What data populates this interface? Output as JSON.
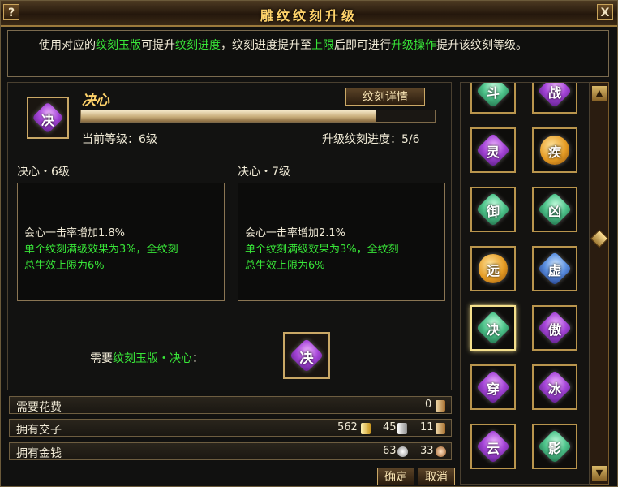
{
  "window": {
    "title": "雕纹纹刻升级",
    "help_label": "?",
    "close_label": "X"
  },
  "notice": {
    "p1": "使用对应的",
    "g1": "纹刻玉版",
    "p2": "可提升",
    "g2": "纹刻进度",
    "p3": "，纹刻进度提升至",
    "g3": "上限",
    "p4": "后即可进行",
    "g4": "升级操作",
    "p5": "提升该纹刻等级。"
  },
  "skill": {
    "icon_glyph": "决",
    "name": "决心",
    "detail_button": "纹刻详情",
    "progress_ratio": 0.8333,
    "current_level_label": "当前等级：6级",
    "progress_label": "升级纹刻进度：5/6"
  },
  "current": {
    "header": "决心・6级",
    "line1": "会心一击率增加1.8%",
    "line2": "单个纹刻满级效果为3%，全纹刻",
    "line3": "总生效上限为6%"
  },
  "next": {
    "header": "决心・7级",
    "line1": "会心一击率增加2.1%",
    "line2": "单个纹刻满级效果为3%，全纹刻",
    "line3": "总生效上限为6%"
  },
  "requirement": {
    "prefix": "需要",
    "item": "纹刻玉版・决心",
    "suffix": "：",
    "icon_glyph": "决"
  },
  "costs": {
    "cost_label": "需要花费",
    "cost_value": "0",
    "jiaozi_label": "拥有交子",
    "jiaozi_gold": "562",
    "jiaozi_silver": "45",
    "jiaozi_copper": "11",
    "money_label": "拥有金钱",
    "money_silver": "63",
    "money_copper": "33"
  },
  "buttons": {
    "confirm": "确定",
    "cancel": "取消"
  },
  "colors": {
    "accent_gold": "#ffd36b",
    "highlight_green": "#38e538",
    "frame_gold": "#caa866"
  },
  "grid": {
    "items": [
      {
        "glyph": "斗",
        "color": "gem-g"
      },
      {
        "glyph": "战",
        "color": "gem-p"
      },
      {
        "glyph": "灵",
        "color": "gem-p"
      },
      {
        "glyph": "疾",
        "color": "gem-o"
      },
      {
        "glyph": "御",
        "color": "gem-g"
      },
      {
        "glyph": "凶",
        "color": "gem-g"
      },
      {
        "glyph": "远",
        "color": "gem-o"
      },
      {
        "glyph": "虚",
        "color": "gem-b"
      },
      {
        "glyph": "决",
        "color": "gem-g"
      },
      {
        "glyph": "傲",
        "color": "gem-p"
      },
      {
        "glyph": "穿",
        "color": "gem-p"
      },
      {
        "glyph": "冰",
        "color": "gem-p"
      },
      {
        "glyph": "云",
        "color": "gem-p"
      },
      {
        "glyph": "影",
        "color": "gem-g"
      }
    ]
  },
  "scroll": {
    "up": "▲",
    "down": "▼"
  }
}
